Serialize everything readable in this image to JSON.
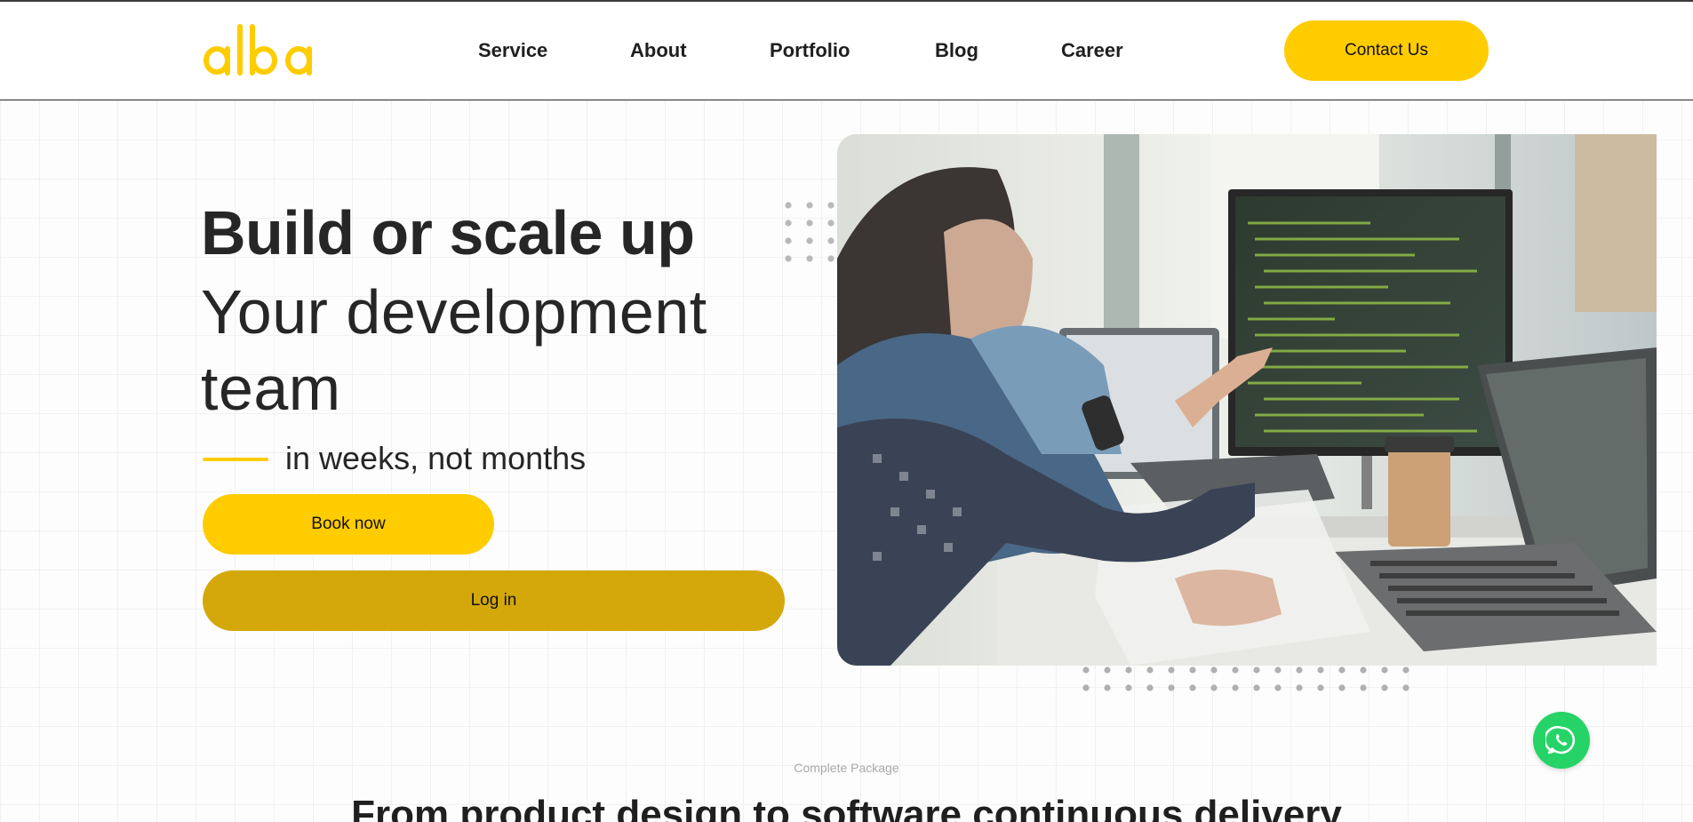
{
  "brand": {
    "logo_text": "alba",
    "accent_color": "#ffcc00",
    "secondary_button_color": "#d4a80b",
    "whatsapp_color": "#25d366"
  },
  "nav": {
    "items": [
      {
        "label": "Service"
      },
      {
        "label": "About"
      },
      {
        "label": "Portfolio"
      },
      {
        "label": "Blog"
      },
      {
        "label": "Career"
      }
    ],
    "contact_label": "Contact Us"
  },
  "hero": {
    "title_bold": "Build or scale up",
    "title_regular": "Your development team",
    "tagline": "in weeks, not months",
    "book_label": "Book now",
    "login_label": "Log in",
    "image_subject": "developers-pointing-at-code-monitor"
  },
  "section": {
    "kicker": "Complete Package",
    "heading": "From product design to software continuous delivery"
  },
  "icons": {
    "logo": "alba-logo",
    "whatsapp": "whatsapp-icon",
    "dots": "dot-pattern-icon"
  }
}
